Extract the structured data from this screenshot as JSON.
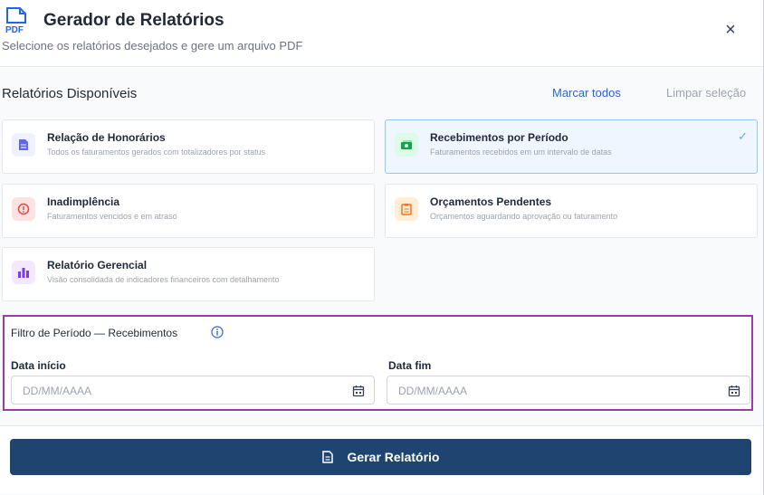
{
  "header": {
    "title": "Gerador de Relatórios",
    "subtitle": "Selecione os relatórios desejados e gere um arquivo PDF",
    "pdf_badge": "PDF",
    "close": "×"
  },
  "reports": {
    "section_title": "Relatórios Disponíveis",
    "mark_all": "Marcar todos",
    "clear_selection": "Limpar seleção",
    "items": [
      {
        "title": "Relação de Honorários",
        "description": "Todos os faturamentos gerados com totalizadores por status",
        "icon": "document-icon",
        "color": "#6366f1",
        "bg": "#eef2ff",
        "selected": false
      },
      {
        "title": "Recebimentos por Período",
        "description": "Faturamentos recebidos em um intervalo de datas",
        "icon": "money-icon",
        "color": "#16a34a",
        "bg": "#dcfce7",
        "selected": true
      },
      {
        "title": "Inadimplência",
        "description": "Faturamentos vencidos e em atraso",
        "icon": "alert-circle-icon",
        "color": "#ef4444",
        "bg": "#fee2e2",
        "selected": false
      },
      {
        "title": "Orçamentos Pendentes",
        "description": "Orçamentos aguardando aprovação ou faturamento",
        "icon": "clipboard-icon",
        "color": "#f97316",
        "bg": "#ffedd5",
        "selected": false
      },
      {
        "title": "Relatório Gerencial",
        "description": "Visão consolidada de indicadores financeiros com detalhamento",
        "icon": "bar-chart-icon",
        "color": "#7c3aed",
        "bg": "#f3e8ff",
        "selected": false
      }
    ],
    "check": "✓"
  },
  "filter": {
    "title": "Filtro de Período — Recebimentos",
    "start_label": "Data início",
    "end_label": "Data fim",
    "start_placeholder": "DD/MM/AAAA",
    "end_placeholder": "DD/MM/AAAA"
  },
  "footer": {
    "generate_label": "Gerar Relatório"
  },
  "colors": {
    "accent": "#1e4470",
    "link": "#2563eb",
    "filter_border": "#9b3aa8"
  }
}
